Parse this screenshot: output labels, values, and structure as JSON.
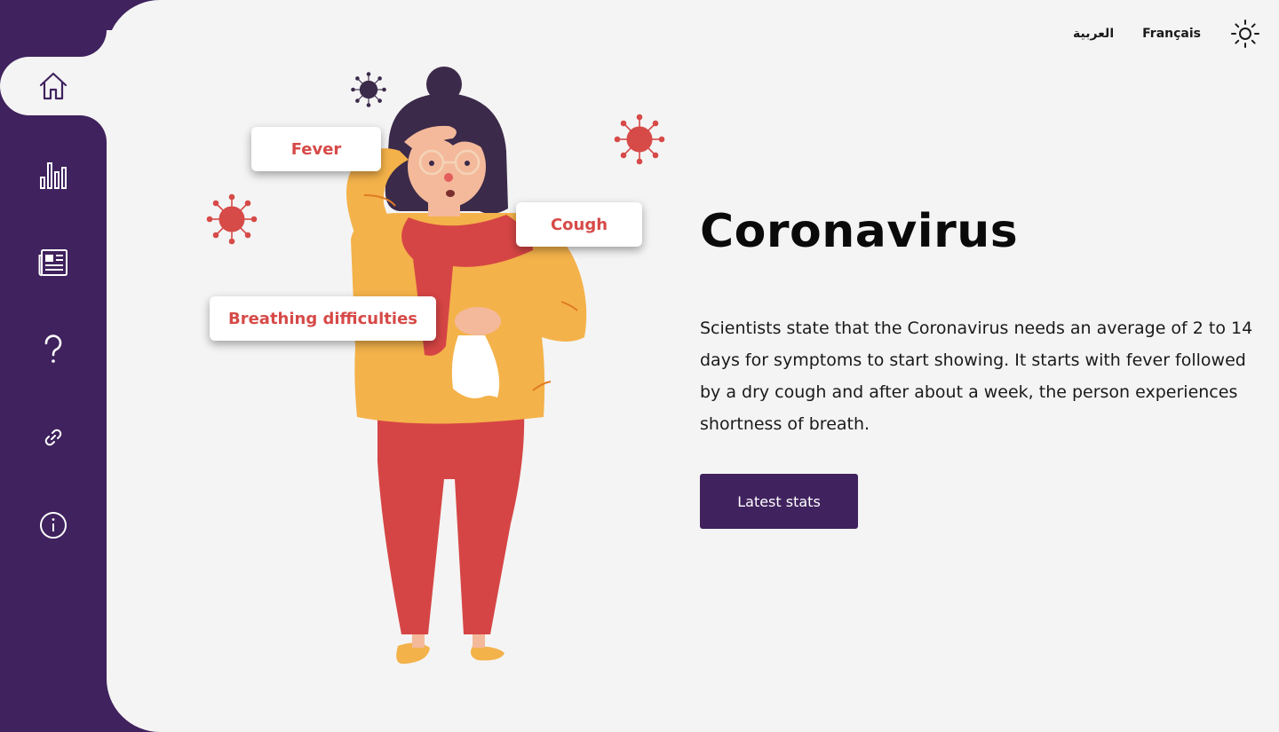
{
  "colors": {
    "accent": "#40225e",
    "panel": "#f4f4f4",
    "symptom_text": "#d64a48",
    "virus_red": "#d64a48",
    "virus_dark": "#3b2a4a"
  },
  "sidebar": {
    "items": [
      {
        "icon": "home-icon",
        "active": true
      },
      {
        "icon": "bar-chart-icon",
        "active": false
      },
      {
        "icon": "newspaper-icon",
        "active": false
      },
      {
        "icon": "question-icon",
        "active": false
      },
      {
        "icon": "link-icon",
        "active": false
      },
      {
        "icon": "info-icon",
        "active": false
      }
    ]
  },
  "header": {
    "arabic_label": "العربية",
    "french_label": "Français",
    "theme_icon": "sun-icon"
  },
  "illustration": {
    "symptoms": {
      "fever": "Fever",
      "cough": "Cough",
      "breathing": "Breathing difficulties"
    }
  },
  "main": {
    "title": "Coronavirus",
    "description": "Scientists state that the Coronavirus needs an average of 2 to 14 days for symptoms to start showing. It starts with fever followed by a dry cough and after about a week, the person experiences shortness of breath.",
    "cta_label": "Latest stats"
  }
}
